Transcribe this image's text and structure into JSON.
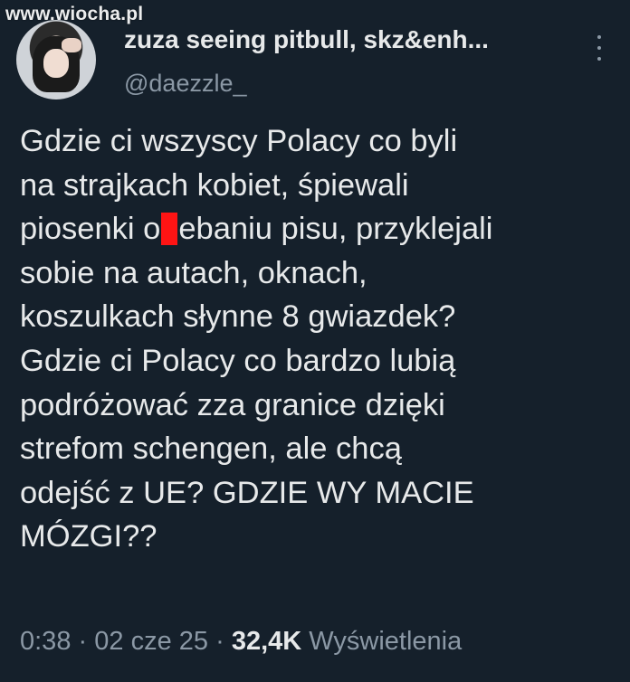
{
  "watermark": "www.wiocha.pl",
  "author": {
    "display_name": "zuza seeing pitbull, skz&enh...",
    "handle": "@daezzle_"
  },
  "tweet": {
    "lines": [
      "Gdzie ci wszyscy Polacy co byli",
      "na strajkach kobiet, śpiewali",
      "koszulkach słynne 8 gwiazdek?",
      "Gdzie ci Polacy co bardzo lubią",
      "podróżować zza granice dzięki",
      "strefom schengen, ale chcą",
      "odejść z UE? GDZIE WY MACIE",
      "MÓZGI??"
    ],
    "line3_before": "piosenki o",
    "line3_after": "ebaniu pisu, przyklejali",
    "line4": "sobie na autach, oknach,"
  },
  "meta": {
    "time": "0:38",
    "separator": "·",
    "date": "02 cze 25",
    "views_count": "32,4K",
    "views_label": "Wyświetlenia"
  },
  "icons": {
    "more": "more-vertical-icon",
    "censor": "red-censor-bar"
  },
  "colors": {
    "background": "#15202b",
    "text": "#e7e9ea",
    "secondary_text": "#8b98a5",
    "censor": "#ff1414"
  }
}
